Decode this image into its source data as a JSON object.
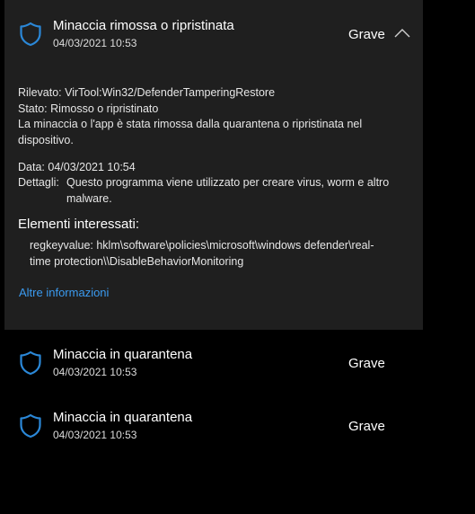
{
  "colors": {
    "panel_bg": "#1f1f1f",
    "page_bg": "#000000",
    "accent": "#2b88d8",
    "link": "#3b9bf0"
  },
  "expanded_item": {
    "title": "Minaccia rimossa o ripristinata",
    "date": "04/03/2021 10:53",
    "severity": "Grave",
    "icon": "shield-icon",
    "collapse_icon": "chevron-up-icon",
    "detected_label": "Rilevato:",
    "detected_value": "VirTool:Win32/DefenderTamperingRestore",
    "status_label": "Stato:",
    "status_value": "Rimosso o ripristinato",
    "description_line1": "La minaccia o l'app è stata rimossa dalla quarantena o ripristinata nel",
    "description_line2": "dispositivo.",
    "data_label": "Data:",
    "data_value": "04/03/2021 10:54",
    "details_label": "Dettagli:",
    "details_line1": "Questo programma viene utilizzato per creare virus, worm e altro",
    "details_line2": "malware.",
    "affected_heading": "Elementi interessati:",
    "affected_line1": "regkeyvalue: hklm\\software\\policies\\microsoft\\windows defender\\real-",
    "affected_line2": "time protection\\\\DisableBehaviorMonitoring",
    "more_info": "Altre informazioni"
  },
  "items": [
    {
      "title": "Minaccia in quarantena",
      "date": "04/03/2021 10:53",
      "severity": "Grave",
      "icon": "shield-icon"
    },
    {
      "title": "Minaccia in quarantena",
      "date": "04/03/2021 10:53",
      "severity": "Grave",
      "icon": "shield-icon"
    }
  ]
}
